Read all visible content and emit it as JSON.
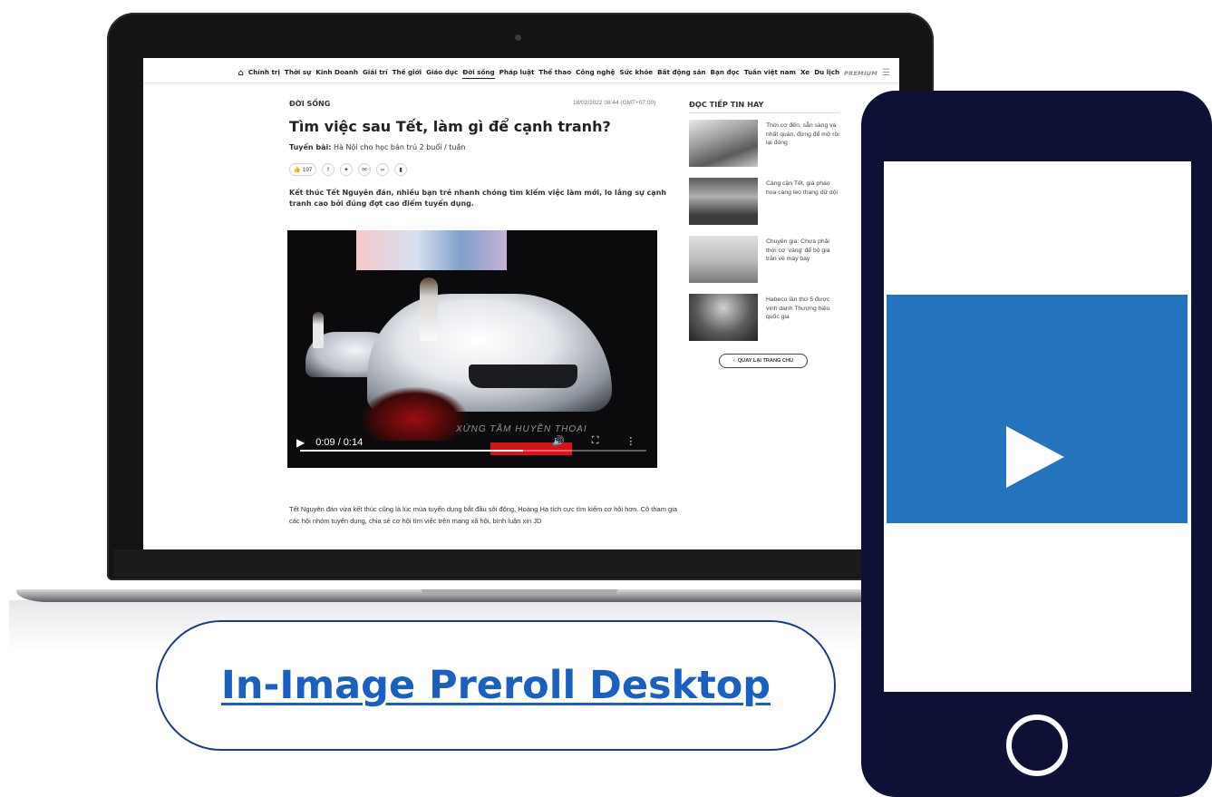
{
  "nav": {
    "items": [
      "Chính trị",
      "Thời sự",
      "Kinh Doanh",
      "Giải trí",
      "Thế giới",
      "Giáo dục",
      "Đời sống",
      "Pháp luật",
      "Thể thao",
      "Công nghệ",
      "Sức khỏe",
      "Bất động sản",
      "Bạn đọc",
      "Tuần việt nam",
      "Xe",
      "Du lịch"
    ],
    "active": "Đời sống",
    "premium": "PREMIUM",
    "home_icon": "home-icon",
    "menu_icon": "hamburger-menu-icon"
  },
  "article": {
    "category": "ĐỜI SỐNG",
    "date": "18/02/2022  08:44 (GMT+07:00)",
    "title": "Tìm việc sau Tết, làm gì để cạnh tranh?",
    "series_label": "Tuyến bài:",
    "series_text": "Hà Nội cho học bán trú 2 buổi / tuần",
    "likes": "197",
    "lead": "Kết thúc Tết Nguyên đán, nhiều bạn trẻ nhanh chóng tìm kiếm việc làm mới, lo lắng sự cạnh tranh cao bởi đúng đợt cao điểm tuyển dụng.",
    "body": "Tết Nguyên đán vừa kết thúc cũng là lúc mùa tuyển dụng bắt đầu sôi động, Hoàng Hạ tích cực tìm kiếm cơ hội hơn. Cô tham gia các hội nhóm tuyển dụng, chia sẻ cơ hội tìm việc trên mạng xã hội, bình luận xin JD"
  },
  "video": {
    "time": "0:09 / 0:14",
    "progress": 0.643,
    "overlay_text": "XỨNG TẦM HUYỀN THOẠI"
  },
  "sidebar": {
    "title": "ĐỌC TIẾP TIN HAY",
    "items": [
      {
        "text": "Thời cơ đến, sẵn sàng và nhất quán, đừng để mở rồi lại đóng"
      },
      {
        "text": "Càng cận Tết, giá pháo hoa càng leo thang dữ dội"
      },
      {
        "text": "Chuyên gia: Chưa phải thời cơ 'vàng' để bỏ giá trần vé máy bay"
      },
      {
        "text": "Habeco lần thứ 5 được vinh danh Thương hiệu quốc gia"
      }
    ],
    "back_home": "QUAY LẠI TRANG CHỦ"
  },
  "caption": {
    "label": "In-Image Preroll Desktop"
  },
  "colors": {
    "phone_body": "#0f1036",
    "phone_video": "#2473bd",
    "caption_text": "#1b5fc1",
    "caption_border": "#1b3a8f"
  }
}
